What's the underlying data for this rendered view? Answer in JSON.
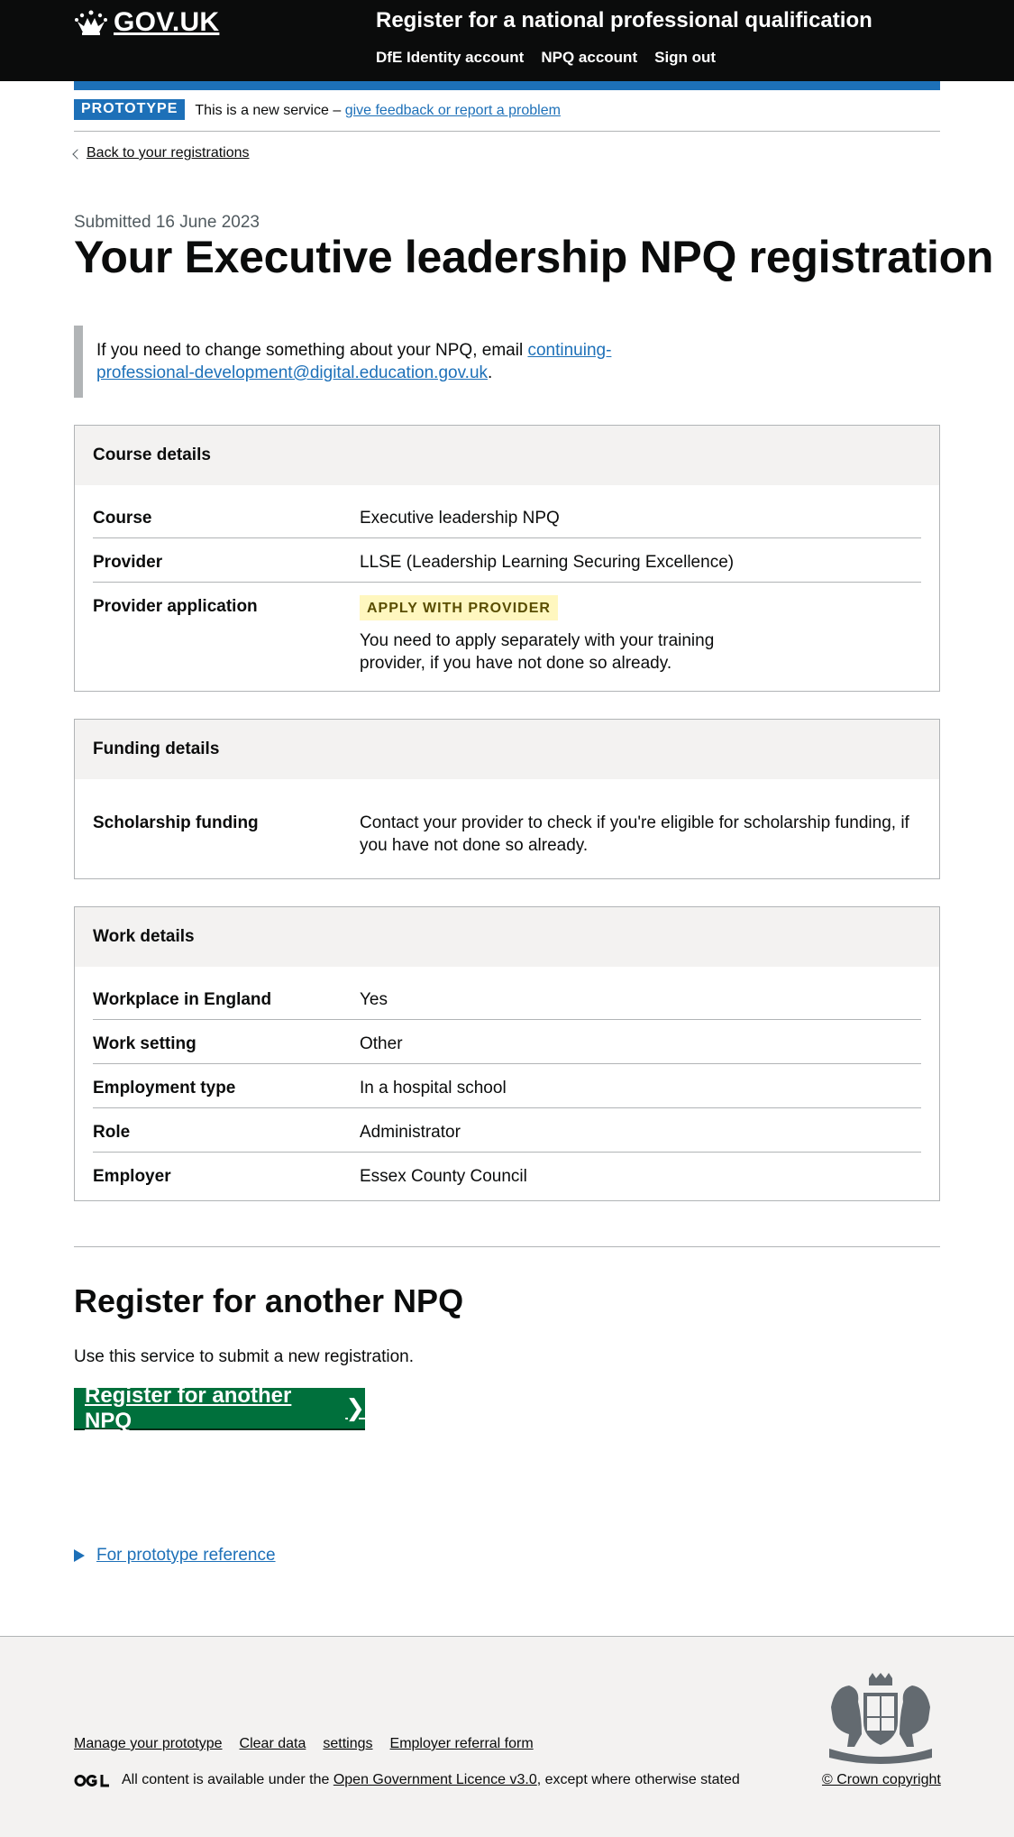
{
  "header": {
    "logo_text": "GOV.UK",
    "service_name": "Register for a national professional qualification",
    "nav": [
      "DfE Identity account",
      "NPQ account",
      "Sign out"
    ]
  },
  "phase_banner": {
    "tag": "PROTOTYPE",
    "text": "This is a new service –",
    "link": "give feedback or report a problem"
  },
  "back_link": "Back to your registrations",
  "caption": "Submitted 16 June 2023",
  "title": "Your Executive leadership NPQ registration",
  "inset": {
    "text": "If you need to change something about your NPQ, email",
    "link": "continuing-professional-development@digital.education.gov.uk",
    "suffix": "."
  },
  "course_card": {
    "title": "Course details",
    "rows": [
      {
        "key": "Course",
        "value": "Executive leadership NPQ"
      },
      {
        "key": "Provider",
        "value": "LLSE (Leadership Learning Securing Excellence)"
      },
      {
        "key": "Provider application",
        "tag": "APPLY WITH PROVIDER",
        "value": "You need to apply separately with your training provider, if you have not done so already."
      }
    ]
  },
  "funding_card": {
    "title": "Funding details",
    "rows": [
      {
        "key": "Scholarship funding",
        "value": "Contact your provider to check if you're eligible for scholarship funding, if you have not done so already."
      }
    ]
  },
  "work_card": {
    "title": "Work details",
    "rows": [
      {
        "key": "Workplace in England",
        "value": "Yes"
      },
      {
        "key": "Work setting",
        "value": "Other"
      },
      {
        "key": "Employment type",
        "value": "In a hospital school"
      },
      {
        "key": "Role",
        "value": "Administrator"
      },
      {
        "key": "Employer",
        "value": "Essex County Council"
      }
    ]
  },
  "another": {
    "heading": "Register for another NPQ",
    "body": "Use this service to submit a new registration.",
    "button": "Register for another NPQ",
    "button_arrow": "❯"
  },
  "details_summary": "For prototype reference",
  "footer": {
    "links": [
      "Manage your prototype",
      "Clear data",
      "settings",
      "Employer referral form"
    ],
    "licence_prefix": "All content is available under the",
    "licence_link": "Open Government Licence v3.0",
    "licence_suffix": ", except where otherwise stated",
    "copyright": "© Crown copyright"
  }
}
